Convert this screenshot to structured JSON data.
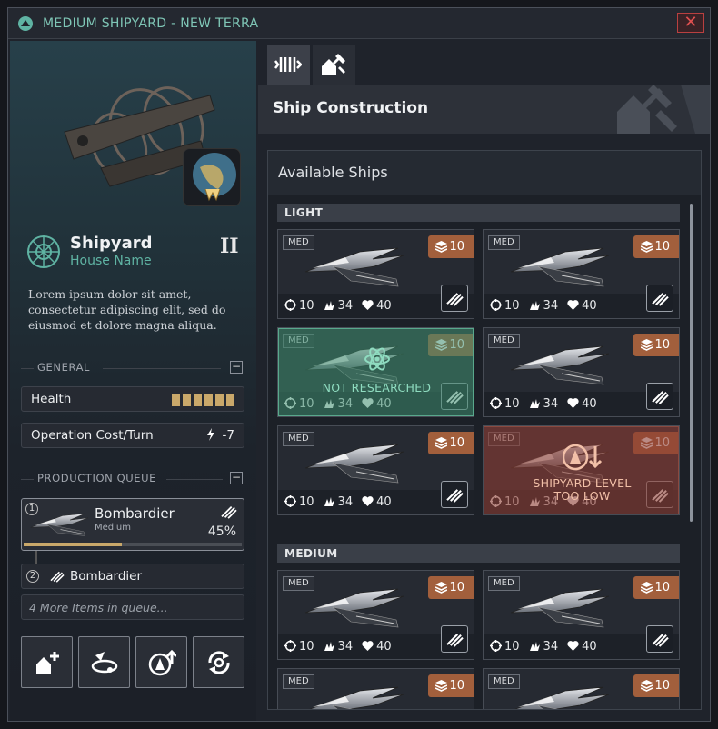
{
  "window": {
    "title": "MEDIUM SHIPYARD - NEW TERRA",
    "close_label": "✕"
  },
  "building": {
    "name": "Shipyard",
    "house": "House Name",
    "tier": "II",
    "description": "Lorem ipsum dolor sit amet, consectetur adipiscing elit, sed do eiusmod et dolore magna aliqua."
  },
  "general": {
    "label": "GENERAL",
    "toggle": "−",
    "health_label": "Health",
    "health_segments": 6,
    "health_fraction": 1.0,
    "cost_label": "Operation Cost/Turn",
    "cost_value": "-7"
  },
  "queue": {
    "label": "PRODUCTION QUEUE",
    "toggle": "−",
    "items": [
      {
        "index": "1",
        "name": "Bombardier",
        "class": "Medium",
        "progress": "45%",
        "progress_value": 0.45
      },
      {
        "index": "2",
        "name": "Bombardier"
      }
    ],
    "more": "4 More Items in queue..."
  },
  "actions": [
    "add-unit-icon",
    "orbit-icon",
    "upgrade-icon",
    "cycle-icon"
  ],
  "tabs": [
    "production-icon",
    "construction-icon"
  ],
  "header": {
    "title": "Ship Construction"
  },
  "panel": {
    "title": "Available Ships",
    "categories": [
      {
        "label": "LIGHT"
      },
      {
        "label": "MEDIUM"
      }
    ],
    "ship_card": {
      "size": "MED",
      "cost": "10",
      "stat1": "10",
      "stat2": "34",
      "stat3": "40"
    },
    "not_researched": "NOT RESEARCHED",
    "too_low_1": "SHIPYARD LEVEL",
    "too_low_2": "TOO LOW"
  },
  "colors": {
    "accent": "#5fb3a3",
    "cost": "#a25f3c",
    "health": "#c9a86a",
    "close": "#e05050"
  }
}
